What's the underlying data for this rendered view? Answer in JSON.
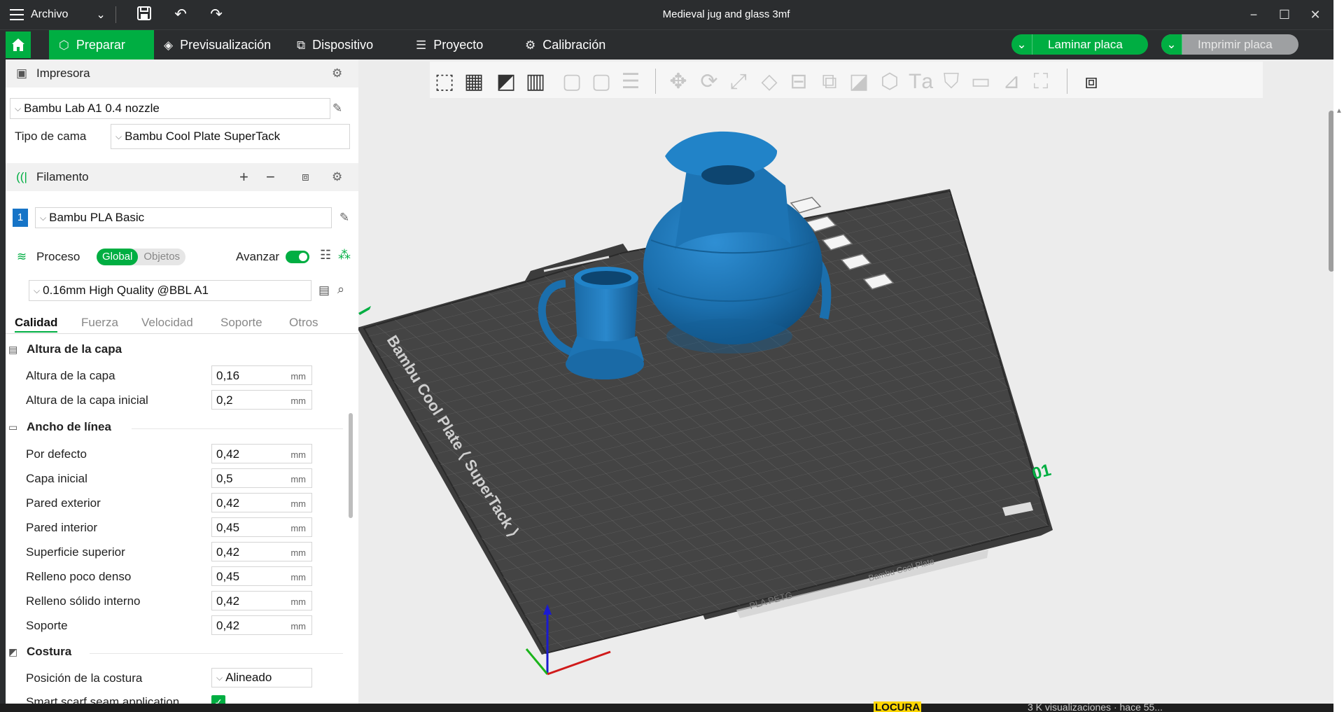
{
  "titlebar": {
    "menu_label": "Archivo",
    "window_title": "Medieval jug and glass 3mf",
    "minimize": "−",
    "maximize": "☐",
    "close": "✕"
  },
  "nav": {
    "tabs": [
      {
        "label": "Preparar",
        "icon": "cube-icon"
      },
      {
        "label": "Previsualización",
        "icon": "layers-icon"
      },
      {
        "label": "Dispositivo",
        "icon": "device-icon"
      },
      {
        "label": "Proyecto",
        "icon": "list-icon"
      },
      {
        "label": "Calibración",
        "icon": "gear-icon"
      }
    ],
    "slice_button": "Laminar placa",
    "print_button": "Imprimir placa"
  },
  "printer": {
    "header": "Impresora",
    "printer_name": "Bambu Lab A1 0.4 nozzle",
    "bed_type_label": "Tipo de cama",
    "bed_type": "Bambu Cool Plate SuperTack"
  },
  "filament": {
    "header": "Filamento",
    "slot_number": "1",
    "name": "Bambu PLA Basic"
  },
  "process": {
    "header": "Proceso",
    "scope_global": "Global",
    "scope_objects": "Objetos",
    "advanced_label": "Avanzar",
    "profile": "0.16mm High Quality @BBL A1",
    "tabs": [
      "Calidad",
      "Fuerza",
      "Velocidad",
      "Soporte",
      "Otros"
    ]
  },
  "settings": {
    "layer_group": "Altura de la capa",
    "layer_rows": [
      {
        "label": "Altura de la capa",
        "value": "0,16",
        "unit": "mm"
      },
      {
        "label": "Altura de la capa inicial",
        "value": "0,2",
        "unit": "mm"
      }
    ],
    "width_group": "Ancho de línea",
    "width_rows": [
      {
        "label": "Por defecto",
        "value": "0,42",
        "unit": "mm"
      },
      {
        "label": "Capa inicial",
        "value": "0,5",
        "unit": "mm"
      },
      {
        "label": "Pared exterior",
        "value": "0,42",
        "unit": "mm"
      },
      {
        "label": "Pared interior",
        "value": "0,45",
        "unit": "mm"
      },
      {
        "label": "Superficie superior",
        "value": "0,42",
        "unit": "mm"
      },
      {
        "label": "Relleno poco denso",
        "value": "0,45",
        "unit": "mm"
      },
      {
        "label": "Relleno sólido interno",
        "value": "0,42",
        "unit": "mm"
      },
      {
        "label": "Soporte",
        "value": "0,42",
        "unit": "mm"
      }
    ],
    "seam_group": "Costura",
    "seam_position_label": "Posición de la costura",
    "seam_position_value": "Alineado",
    "smart_scarf_label": "Smart scarf seam application"
  },
  "plate": {
    "plate_text": "Bambu Cool Plate ⟨ SuperTack ⟩",
    "plate_number": "01",
    "front_text": "PLA  PETG",
    "front_text2": "Bambu Cool Plate"
  },
  "background_peek": {
    "text1": "LOCURA",
    "text2": "3 K visualizaciones · hace 55..."
  },
  "colors": {
    "accent": "#00ae42",
    "model_blue": "#1b6fad",
    "bed": "#4a4a4a"
  }
}
